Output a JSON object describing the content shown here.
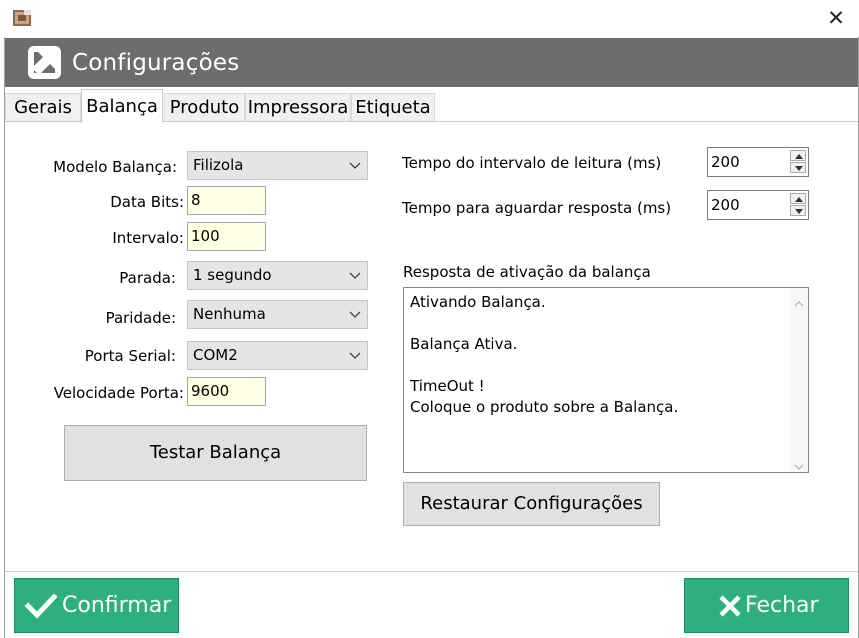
{
  "window": {
    "close_glyph": "✕",
    "title": "Configurações",
    "app_icon": "app-package-icon",
    "header_icon": "arrow-up-right-icon"
  },
  "tabs": [
    {
      "label": "Gerais",
      "active": false
    },
    {
      "label": "Balança",
      "active": true
    },
    {
      "label": "Produto",
      "active": false
    },
    {
      "label": "Impressora",
      "active": false
    },
    {
      "label": "Etiqueta",
      "active": false
    }
  ],
  "balanca": {
    "modelo_label": "Modelo Balança:",
    "modelo_value": "Filizola",
    "data_bits_label": "Data Bits:",
    "data_bits_value": "8",
    "intervalo_label": "Intervalo:",
    "intervalo_value": "100",
    "parada_label": "Parada:",
    "parada_value": "1 segundo",
    "paridade_label": "Paridade:",
    "paridade_value": "Nenhuma",
    "porta_label": "Porta Serial:",
    "porta_value": "COM2",
    "velocidade_label": "Velocidade Porta:",
    "velocidade_value": "9600",
    "testar_button": "Testar Balança",
    "tempo_leitura_label": "Tempo do intervalo de leitura (ms)",
    "tempo_leitura_value": "200",
    "tempo_resposta_label": "Tempo para aguardar resposta (ms)",
    "tempo_resposta_value": "200",
    "resposta_label": "Resposta de ativação da balança",
    "resposta_lines": [
      "Ativando Balança.",
      "",
      "Balança Ativa.",
      "",
      "TimeOut !",
      "Coloque o produto sobre a Balança."
    ],
    "restaurar_button": "Restaurar Configurações"
  },
  "footer": {
    "confirmar_label": "Confirmar",
    "fechar_label": "Fechar",
    "green": "#2eaf7f"
  }
}
